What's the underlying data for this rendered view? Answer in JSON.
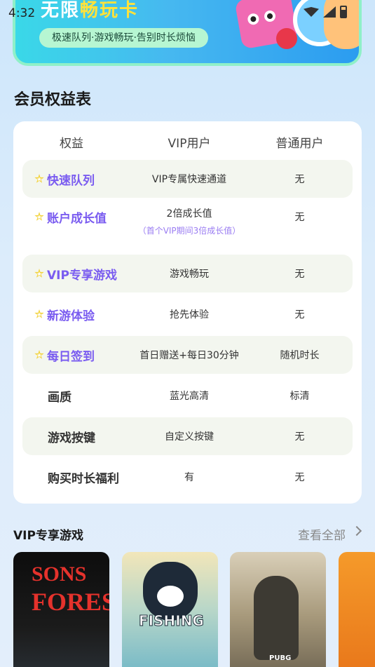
{
  "status_bar": {
    "time": "4:32"
  },
  "banner": {
    "title_prefix": "无限",
    "title_highlight": "畅玩卡",
    "subtitle": "极速队列·游戏畅玩·告别时长烦恼"
  },
  "benefits": {
    "title": "会员权益表",
    "headers": [
      "权益",
      "VIP用户",
      "普通用户"
    ],
    "rows": [
      {
        "name": "快速队列",
        "vip": "VIP专属快速通道",
        "vip_note": "",
        "normal": "无"
      },
      {
        "name": "账户成长值",
        "vip": "2倍成长值",
        "vip_note": "（首个VIP期间3倍成长值）",
        "normal": "无"
      },
      {
        "name": "VIP专享游戏",
        "vip": "游戏畅玩",
        "vip_note": "",
        "normal": "无"
      },
      {
        "name": "新游体验",
        "vip": "抢先体验",
        "vip_note": "",
        "normal": "无"
      },
      {
        "name": "每日签到",
        "vip": "首日赠送+每日30分钟",
        "vip_note": "",
        "normal": "随机时长"
      },
      {
        "name": "画质",
        "vip": "蓝光高清",
        "vip_note": "",
        "normal": "标清"
      },
      {
        "name": "游戏按键",
        "vip": "自定义按键",
        "vip_note": "",
        "normal": "无"
      },
      {
        "name": "购买时长福利",
        "vip": "有",
        "vip_note": "",
        "normal": "无"
      }
    ]
  },
  "games": {
    "title": "VIP专享游戏",
    "view_all": "查看全部",
    "items": [
      {
        "line1": "SONS",
        "line2": "FOREST"
      },
      {
        "line1": "FISHING"
      },
      {
        "line1": "PUBG"
      },
      {
        "line1": ""
      }
    ]
  },
  "colors": {
    "accent_purple": "#7a5cf0",
    "star_yellow": "#f2d23a",
    "row_shade": "#f3f6ef"
  }
}
